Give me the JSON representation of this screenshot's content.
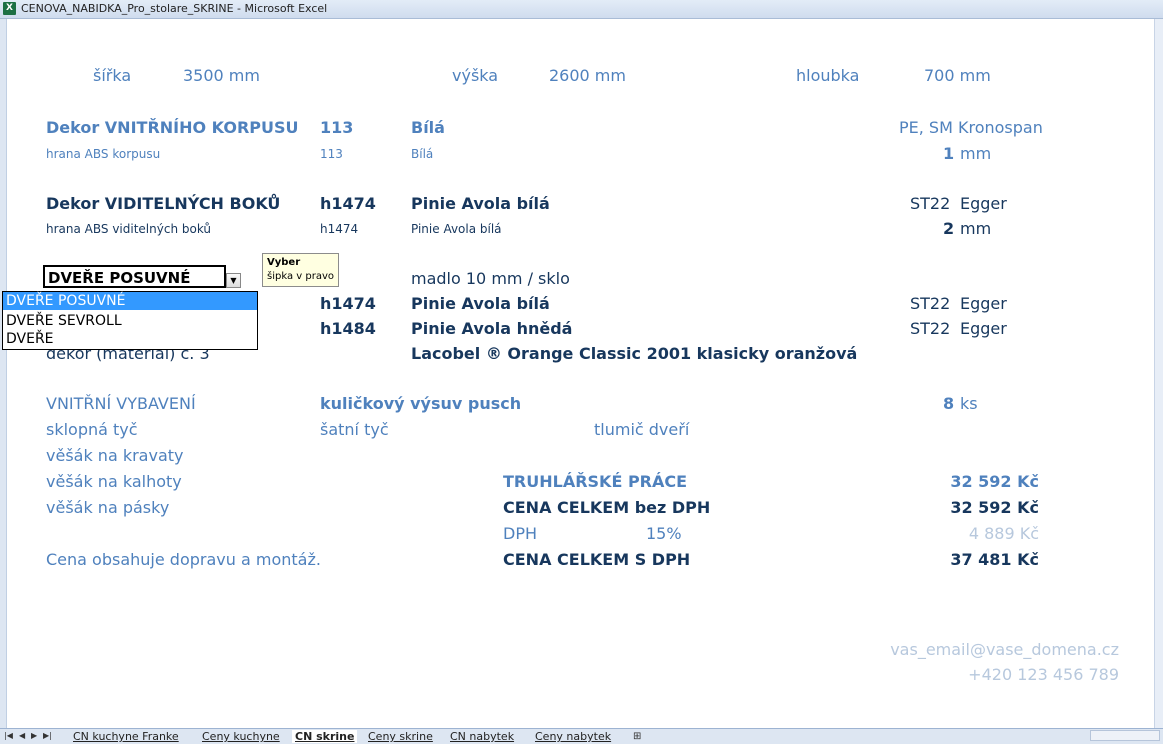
{
  "window": {
    "title": "CENOVA_NABIDKA_Pro_stolare_SKRINE - Microsoft Excel",
    "icon": "excel-icon"
  },
  "dims": {
    "sirka_label": "šířka",
    "sirka_value": "3500 mm",
    "vyska_label": "výška",
    "vyska_value": "2600 mm",
    "hloubka_label": "hloubka",
    "hloubka_value": "700 mm"
  },
  "korpus": {
    "label": "Dekor VNITŘNÍHO KORPUSU",
    "code": "113",
    "name": "Bílá",
    "spec": "PE, SM Kronospan",
    "edge_label": "hrana ABS korpusu",
    "edge_code": "113",
    "edge_name": "Bílá",
    "edge_num": "1",
    "edge_unit": "mm"
  },
  "boky": {
    "label": "Dekor VIDITELNÝCH BOKŮ",
    "code": "h1474",
    "name": "Pinie Avola bílá",
    "spec1": "ST22",
    "spec2": "Egger",
    "edge_label": "hrana ABS viditelných boků",
    "edge_code": "h1474",
    "edge_name": "Pinie Avola bílá",
    "edge_num": "2",
    "edge_unit": "mm"
  },
  "doors": {
    "selected": "DVEŘE POSUVNÉ",
    "options": [
      "DVEŘE POSUVNÉ",
      "DVEŘE SEVROLL",
      "DVEŘE"
    ],
    "handle": "madlo 10 mm / sklo",
    "row1": {
      "code": "h1474",
      "name": "Pinie Avola bílá",
      "spec1": "ST22",
      "spec2": "Egger"
    },
    "row2": {
      "code": "h1484",
      "name": "Pinie Avola hnědá",
      "spec1": "ST22",
      "spec2": "Egger"
    },
    "row3": {
      "label": "dekor (materiál) č. 3",
      "name": "Lacobel ® Orange Classic 2001 klasicky oranžová"
    }
  },
  "tooltip": {
    "title": "Vyber",
    "text": "šipka v pravo"
  },
  "vybaveni": {
    "label": "VNITŘNÍ VYBAVENÍ",
    "item": "kuličkový výsuv pusch",
    "qty": "8",
    "unit": "ks",
    "items": [
      "sklopná tyč",
      "šatní tyč",
      "tlumič dveří",
      "věšák na kravaty",
      "věšák na kalhoty",
      "věšák na pásky"
    ]
  },
  "prices": {
    "truhlar_label": "TRUHLÁŘSKÉ PRÁCE",
    "truhlar_value": "32 592 Kč",
    "bez_label": "CENA CELKEM bez DPH",
    "bez_value": "32 592 Kč",
    "dph_label": "DPH",
    "dph_rate": "15%",
    "dph_value": "4 889 Kč",
    "s_label": "CENA CELKEM S DPH",
    "s_value": "37 481 Kč"
  },
  "note": "Cena obsahuje dopravu a montáž.",
  "contact": {
    "email": "vas_email@vase_domena.cz",
    "phone": "+420 123 456 789"
  },
  "sheets": [
    "CN kuchyne Franke",
    "Ceny kuchyne",
    "CN skrine",
    "Ceny skrine",
    "CN nabytek",
    "Ceny nabytek"
  ],
  "active_sheet": "CN skrine"
}
